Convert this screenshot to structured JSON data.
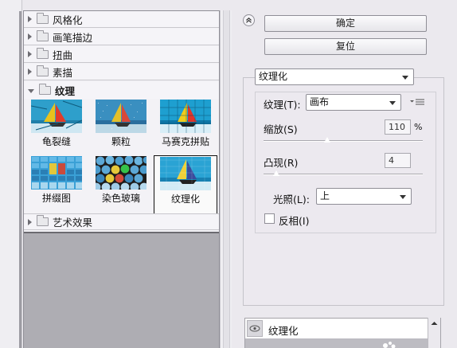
{
  "categories": [
    {
      "label": "风格化"
    },
    {
      "label": "画笔描边"
    },
    {
      "label": "扭曲"
    },
    {
      "label": "素描"
    },
    {
      "label": "纹理"
    },
    {
      "label": "艺术效果"
    }
  ],
  "thumbnails": [
    {
      "label": "龟裂缝"
    },
    {
      "label": "颗粒"
    },
    {
      "label": "马赛克拼贴"
    },
    {
      "label": "拼缀图"
    },
    {
      "label": "染色玻璃"
    },
    {
      "label": "纹理化"
    }
  ],
  "buttons": {
    "ok": "确定",
    "reset": "复位"
  },
  "filter_select": {
    "value": "纹理化"
  },
  "texture": {
    "label": "纹理(T):",
    "value": "画布",
    "menu_icon": "menu-icon"
  },
  "scaling": {
    "label": "缩放(S)",
    "value": "110",
    "unit": "%",
    "level": 110
  },
  "relief": {
    "label": "凸现(R)",
    "value": "4",
    "level": 4
  },
  "light": {
    "label": "光照(L):",
    "value": "上"
  },
  "invert": {
    "label": "反相(I)",
    "checked": false
  },
  "layer": {
    "name": "纹理化",
    "icon": "eye-icon"
  },
  "colors": {
    "panel": "#ebe9ee",
    "gray_area": "#aeadb3",
    "sea": "#2e9fcb"
  }
}
